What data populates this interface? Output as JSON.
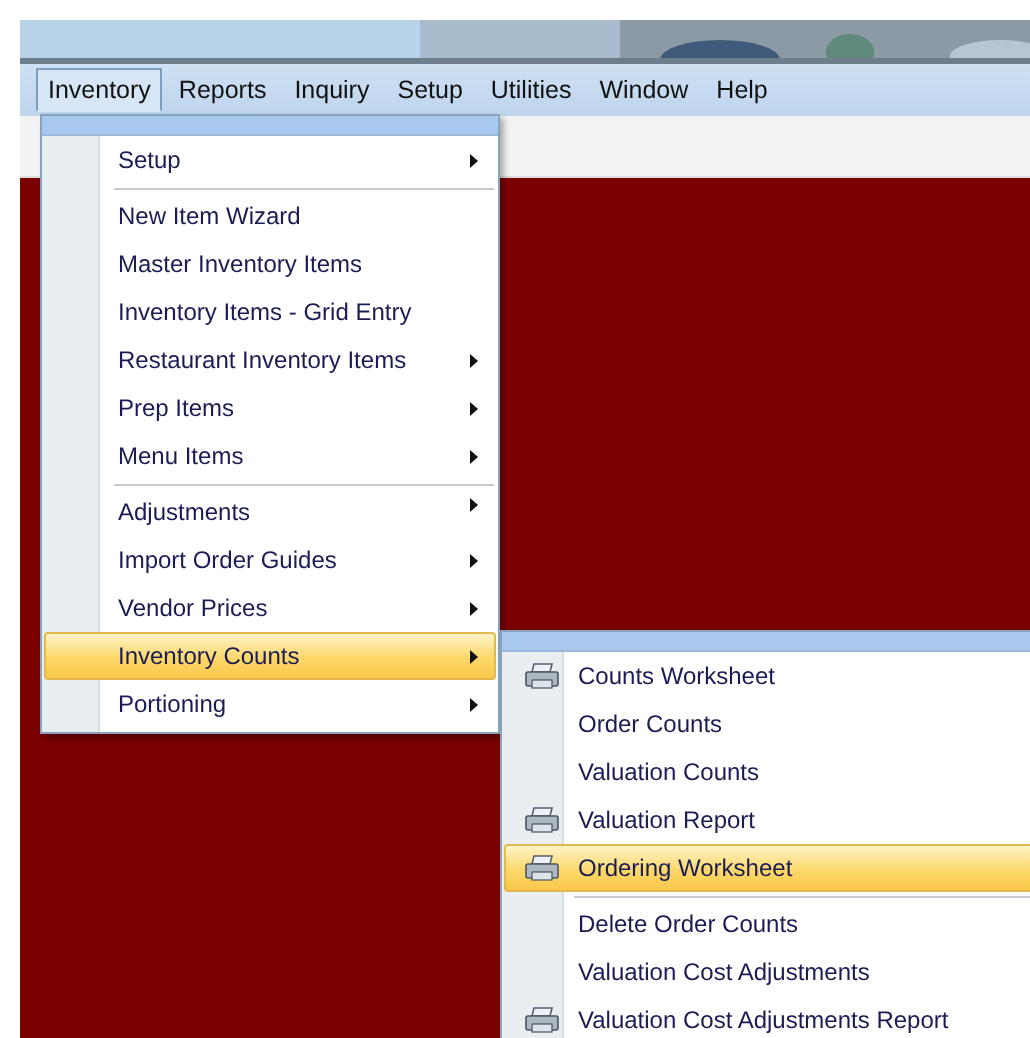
{
  "menubar": [
    {
      "label": "Inventory",
      "selected": true
    },
    {
      "label": "Reports",
      "selected": false
    },
    {
      "label": "Inquiry",
      "selected": false
    },
    {
      "label": "Setup",
      "selected": false
    },
    {
      "label": "Utilities",
      "selected": false
    },
    {
      "label": "Window",
      "selected": false
    },
    {
      "label": "Help",
      "selected": false
    }
  ],
  "inventory_menu": {
    "items": [
      {
        "label": "Setup",
        "submenu": true,
        "selected": false,
        "separator_before": false
      },
      {
        "label": "New Item Wizard",
        "submenu": false,
        "selected": false,
        "separator_before": true
      },
      {
        "label": "Master Inventory Items",
        "submenu": false,
        "selected": false,
        "separator_before": false
      },
      {
        "label": "Inventory Items - Grid Entry",
        "submenu": false,
        "selected": false,
        "separator_before": false
      },
      {
        "label": "Restaurant Inventory Items",
        "submenu": true,
        "selected": false,
        "separator_before": false
      },
      {
        "label": "Prep Items",
        "submenu": true,
        "selected": false,
        "separator_before": false
      },
      {
        "label": "Menu Items",
        "submenu": true,
        "selected": false,
        "separator_before": false
      },
      {
        "label": "Adjustments",
        "submenu": true,
        "selected": false,
        "separator_before": true
      },
      {
        "label": "Import Order Guides",
        "submenu": true,
        "selected": false,
        "separator_before": false
      },
      {
        "label": "Vendor Prices",
        "submenu": true,
        "selected": false,
        "separator_before": false
      },
      {
        "label": "Inventory Counts",
        "submenu": true,
        "selected": true,
        "separator_before": false
      },
      {
        "label": "Portioning",
        "submenu": true,
        "selected": false,
        "separator_before": false
      }
    ]
  },
  "inventory_counts_menu": {
    "items": [
      {
        "label": "Counts Worksheet",
        "printer_icon": true,
        "selected": false,
        "separator_before": false
      },
      {
        "label": "Order Counts",
        "printer_icon": false,
        "selected": false,
        "separator_before": false
      },
      {
        "label": "Valuation Counts",
        "printer_icon": false,
        "selected": false,
        "separator_before": false
      },
      {
        "label": "Valuation Report",
        "printer_icon": true,
        "selected": false,
        "separator_before": false
      },
      {
        "label": "Ordering Worksheet",
        "printer_icon": true,
        "selected": true,
        "separator_before": false
      },
      {
        "label": "Delete Order Counts",
        "printer_icon": false,
        "selected": false,
        "separator_before": true
      },
      {
        "label": "Valuation Cost Adjustments",
        "printer_icon": false,
        "selected": false,
        "separator_before": false
      },
      {
        "label": "Valuation Cost Adjustments Report",
        "printer_icon": true,
        "selected": false,
        "separator_before": false
      }
    ]
  }
}
